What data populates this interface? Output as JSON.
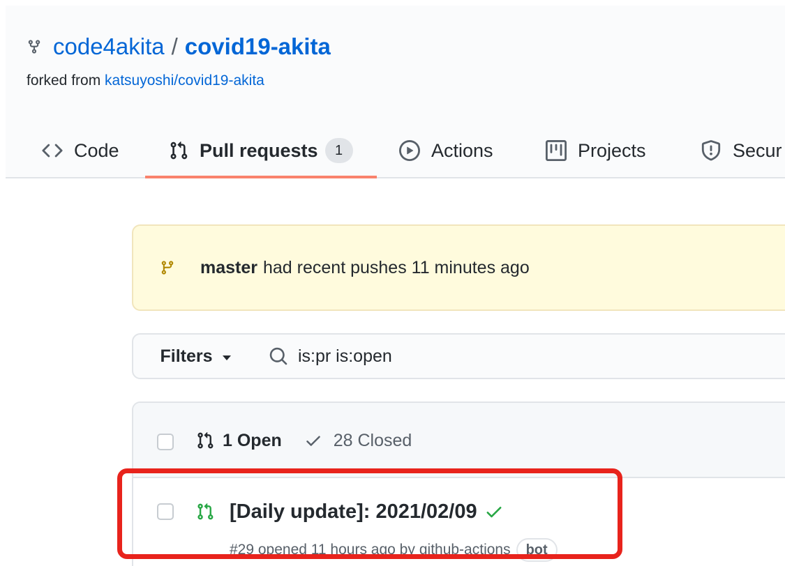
{
  "repo": {
    "owner": "code4akita",
    "separator": "/",
    "name": "covid19-akita",
    "forked_prefix": "forked from",
    "forked_source": "katsuyoshi/covid19-akita",
    "icon": "repo-forked-icon"
  },
  "tabs": [
    {
      "label": "Code",
      "icon": "code-icon",
      "selected": false
    },
    {
      "label": "Pull requests",
      "icon": "git-pull-request-icon",
      "selected": true,
      "counter": "1"
    },
    {
      "label": "Actions",
      "icon": "play-icon",
      "selected": false
    },
    {
      "label": "Projects",
      "icon": "project-icon",
      "selected": false
    },
    {
      "label": "Secur",
      "icon": "shield-icon",
      "selected": false
    }
  ],
  "recent_push": {
    "branch": "master",
    "message": "had recent pushes 11 minutes ago",
    "icon": "git-branch-icon"
  },
  "filters": {
    "button_label": "Filters",
    "search_value": "is:pr is:open"
  },
  "states": {
    "open_label": "1 Open",
    "closed_label": "28 Closed"
  },
  "pull_requests": [
    {
      "title": "[Daily update]: 2021/02/09",
      "meta": "#29 opened 11 hours ago by",
      "author": "github-actions",
      "author_label": "bot",
      "status": "success"
    }
  ],
  "colors": {
    "link": "#0366d6",
    "open_green": "#28a745",
    "branch_icon": "#b08800",
    "tab_underline": "#f9826c",
    "highlight": "#e8231c"
  }
}
